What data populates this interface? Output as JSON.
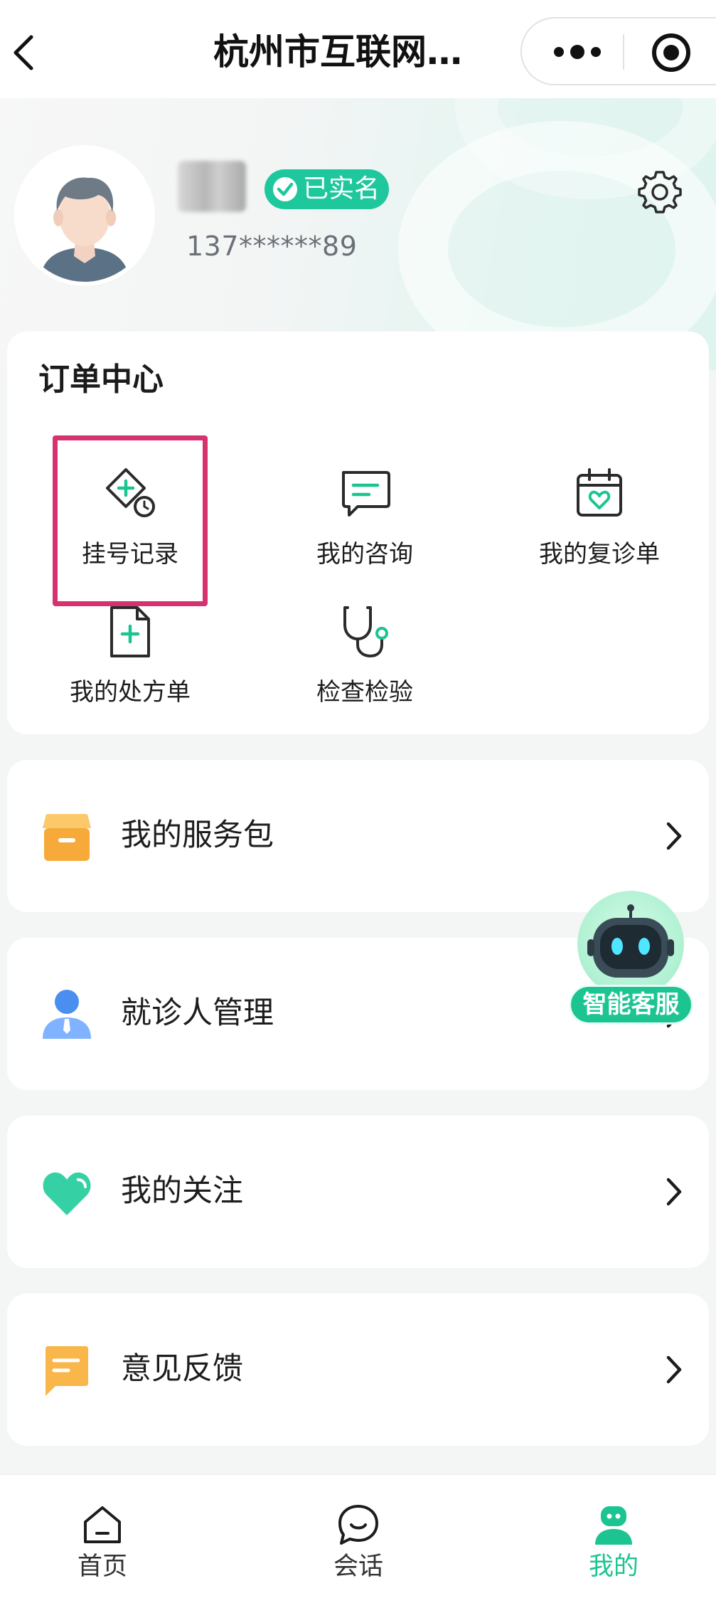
{
  "nav": {
    "title": "杭州市互联网…"
  },
  "profile": {
    "verified_badge": "已实名",
    "phone": "137******89"
  },
  "order_center": {
    "title": "订单中心",
    "items": [
      {
        "label": "挂号记录",
        "icon": "registration-record-icon"
      },
      {
        "label": "我的咨询",
        "icon": "consultation-icon"
      },
      {
        "label": "我的复诊单",
        "icon": "revisit-calendar-icon"
      },
      {
        "label": "我的处方单",
        "icon": "prescription-icon"
      },
      {
        "label": "检查检验",
        "icon": "stethoscope-icon"
      }
    ]
  },
  "menu": [
    {
      "label": "我的服务包",
      "icon": "service-box-icon"
    },
    {
      "label": "就诊人管理",
      "icon": "patient-user-icon"
    },
    {
      "label": "我的关注",
      "icon": "heart-icon"
    },
    {
      "label": "意见反馈",
      "icon": "feedback-icon"
    }
  ],
  "assistant": {
    "label": "智能客服"
  },
  "tabbar": {
    "tabs": [
      {
        "label": "首页",
        "icon": "home-icon"
      },
      {
        "label": "会话",
        "icon": "chat-icon"
      },
      {
        "label": "我的",
        "icon": "profile-icon"
      }
    ],
    "active_index": 2
  },
  "colors": {
    "accent": "#1cc491",
    "highlight": "#d6326f",
    "box_orange": "#f7b13f",
    "user_blue": "#4a8ff0"
  }
}
